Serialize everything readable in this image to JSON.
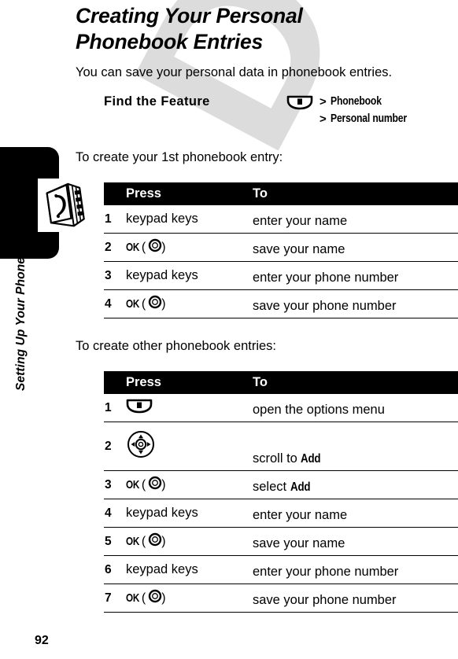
{
  "document": {
    "title": "Creating Your Personal Phonebook Entries",
    "intro": "You can save your personal data in phonebook entries.",
    "page_number": "92"
  },
  "sidebar": {
    "label": "Setting Up Your Phonebook",
    "icon": "phonebook-icon",
    "tab_color": "#000000"
  },
  "find_the_feature": {
    "label": "Find the Feature",
    "menu_icon": "menu-key-icon",
    "separator": ">",
    "path": [
      "Phonebook",
      "Personal number"
    ]
  },
  "sections": [
    {
      "lead_in": "To create your 1st phonebook entry:",
      "table": {
        "headers": {
          "num": "",
          "press": "Press",
          "to": "To"
        },
        "rows": [
          {
            "num": "1",
            "press_kind": "text",
            "press": "keypad keys",
            "to": "enter your name",
            "to_emph": ""
          },
          {
            "num": "2",
            "press_kind": "ok",
            "press": "OK",
            "to": "save your name",
            "to_emph": ""
          },
          {
            "num": "3",
            "press_kind": "text",
            "press": "keypad keys",
            "to": "enter your phone number",
            "to_emph": ""
          },
          {
            "num": "4",
            "press_kind": "ok",
            "press": "OK",
            "to": "save your phone number",
            "to_emph": ""
          }
        ]
      }
    },
    {
      "lead_in": "To create other phonebook entries:",
      "table": {
        "headers": {
          "num": "",
          "press": "Press",
          "to": "To"
        },
        "rows": [
          {
            "num": "1",
            "press_kind": "menu-key-icon",
            "press": "",
            "to": "open the options menu",
            "to_emph": ""
          },
          {
            "num": "2",
            "press_kind": "nav-key-icon",
            "press": "",
            "to": "scroll to ",
            "to_emph": "Add"
          },
          {
            "num": "3",
            "press_kind": "ok",
            "press": "OK",
            "to": "select ",
            "to_emph": "Add"
          },
          {
            "num": "4",
            "press_kind": "text",
            "press": "keypad keys",
            "to": "enter your name",
            "to_emph": ""
          },
          {
            "num": "5",
            "press_kind": "ok",
            "press": "OK",
            "to": "save your name",
            "to_emph": ""
          },
          {
            "num": "6",
            "press_kind": "text",
            "press": "keypad keys",
            "to": "enter your phone number",
            "to_emph": ""
          },
          {
            "num": "7",
            "press_kind": "ok",
            "press": "OK",
            "to": "save your phone number",
            "to_emph": ""
          }
        ]
      }
    }
  ],
  "watermark": {
    "text": "DRAFT",
    "color": "#dcdcdc"
  }
}
